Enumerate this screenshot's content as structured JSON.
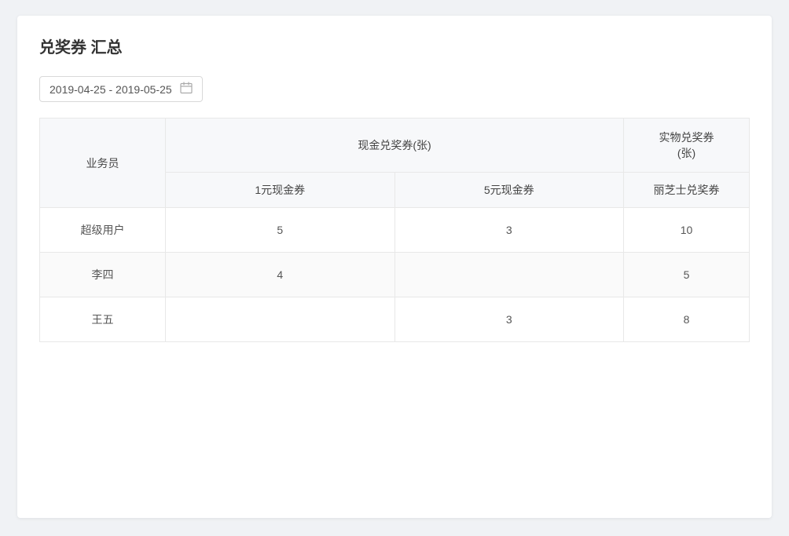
{
  "page": {
    "title": "兑奖券 汇总"
  },
  "dateRange": {
    "value": "2019-04-25 - 2019-05-25",
    "icon": "📅"
  },
  "table": {
    "headers": {
      "salesperson": "业务员",
      "cashCoupons": "现金兑奖券(张)",
      "physicalCoupons": "实物兑奖券\n(张)",
      "cash1Yuan": "1元现金券",
      "cash5Yuan": "5元现金券",
      "lizishiCoupon": "丽芝士兑奖券"
    },
    "rows": [
      {
        "name": "超级用户",
        "cash1Yuan": "5",
        "cash5Yuan": "3",
        "lizishi": "10"
      },
      {
        "name": "李四",
        "cash1Yuan": "4",
        "cash5Yuan": "",
        "lizishi": "5"
      },
      {
        "name": "王五",
        "cash1Yuan": "",
        "cash5Yuan": "3",
        "lizishi": "8"
      }
    ]
  }
}
